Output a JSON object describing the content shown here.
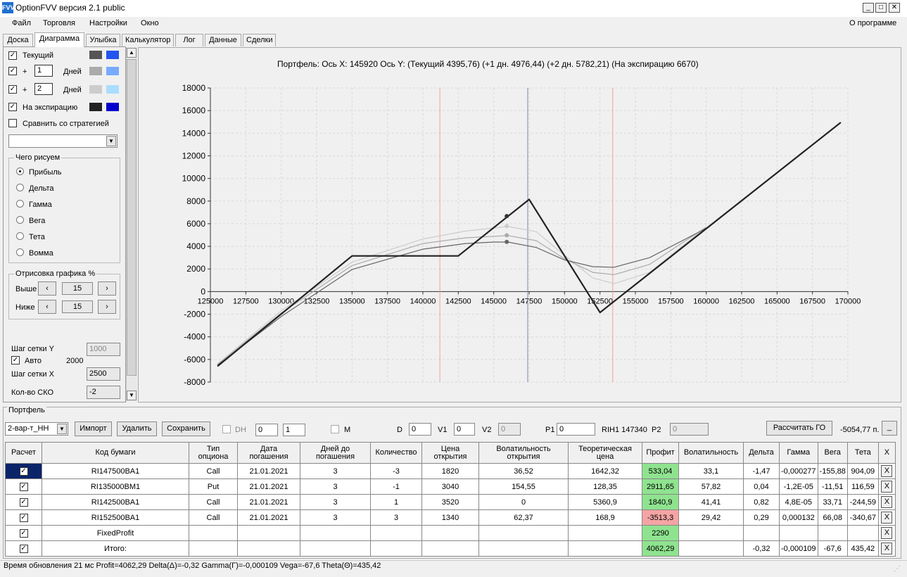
{
  "window": {
    "title": "OptionFVV версия 2.1 public",
    "icon_label": "FVV"
  },
  "menu": [
    "Файл",
    "Торговля",
    "Настройки",
    "Окно"
  ],
  "menu_about": "О программе",
  "tabs": [
    "Доска",
    "Диаграмма",
    "Улыбка",
    "Калькулятор",
    "Лог",
    "Данные",
    "Сделки"
  ],
  "active_tab": "Диаграмма",
  "left": {
    "current_label": "Текущий",
    "plus": "+",
    "days_label": "Дней",
    "days1": "1",
    "days2": "2",
    "expiration_label": "На экспирацию",
    "compare_label": "Сравнить со стратегией",
    "what_group": "Чего рисуем",
    "radios": [
      "Прибыль",
      "Дельта",
      "Гамма",
      "Вега",
      "Тета",
      "Вомма"
    ],
    "selected_radio": "Прибыль",
    "render_group": "Отрисовка графика %",
    "above_label": "Выше",
    "below_label": "Ниже",
    "above_value": "15",
    "below_value": "15",
    "grid_y_label": "Шаг сетки Y",
    "grid_y_value": "1000",
    "auto_label": "Авто",
    "auto_value": "2000",
    "grid_x_label": "Шаг сетки X",
    "grid_x_value": "2500",
    "sko_label": "Кол-во СКО",
    "sko_value": "-2",
    "swatches": {
      "current": [
        "#555555",
        "#2255ee"
      ],
      "d1": [
        "#aaaaaa",
        "#77aaff"
      ],
      "d2": [
        "#cccccc",
        "#aaddff"
      ],
      "exp": [
        "#222222",
        "#0000cc"
      ]
    }
  },
  "chart_header": {
    "text": "Портфель: Ось X: 145920 Ось Y:  (Текущий 4395,76)  (+1 дн. 4976,44)  (+2 дн. 5782,21)  (На экспирацию 6670)"
  },
  "chart_data": {
    "type": "line",
    "xlim": [
      125000,
      170000
    ],
    "ylim": [
      -8000,
      18000
    ],
    "x_ticks": [
      "125000",
      "127500",
      "130000",
      "132500",
      "135000",
      "137500",
      "140000",
      "142500",
      "145000",
      "147500",
      "150000",
      "152500",
      "155000",
      "157500",
      "160000",
      "162500",
      "165000",
      "167500",
      "170000"
    ],
    "y_ticks": [
      "18000",
      "16000",
      "14000",
      "12000",
      "10000",
      "8000",
      "6000",
      "4000",
      "2000",
      "0",
      "-2000",
      "-4000",
      "-6000",
      "-8000"
    ],
    "grid": true,
    "cursor_x": 145920,
    "vlines": [
      {
        "x": 141200,
        "color": "#f4a0a0"
      },
      {
        "x": 147400,
        "color": "#7a8aa8"
      },
      {
        "x": 153400,
        "color": "#f4a0a0"
      }
    ],
    "series": [
      {
        "color": "#222222",
        "x": [
          125500,
          135000,
          142500,
          147500,
          152500,
          169500
        ],
        "y": [
          -6600,
          3150,
          3150,
          8150,
          -1850,
          14950
        ]
      },
      {
        "color": "#cccccc",
        "x": [
          125500,
          130000,
          135000,
          140000,
          143000,
          146000,
          148000,
          150000,
          152000,
          153500,
          156000,
          160000
        ],
        "y": [
          -6400,
          -1700,
          2600,
          4650,
          5350,
          5750,
          5300,
          3200,
          1200,
          700,
          1700,
          5700
        ]
      },
      {
        "color": "#aaaaaa",
        "x": [
          125500,
          130000,
          135000,
          140000,
          143000,
          146000,
          148000,
          150000,
          152000,
          153500,
          156000,
          160000
        ],
        "y": [
          -6450,
          -1900,
          2300,
          4250,
          4750,
          4950,
          4500,
          2900,
          1700,
          1500,
          2400,
          5700
        ]
      },
      {
        "color": "#666666",
        "x": [
          125500,
          130000,
          135000,
          140000,
          143000,
          145000,
          146000,
          148000,
          150000,
          152000,
          153500,
          156000,
          160000
        ],
        "y": [
          -6500,
          -2200,
          1950,
          3750,
          4250,
          4380,
          4380,
          3900,
          2800,
          2200,
          2150,
          3000,
          5600
        ]
      }
    ],
    "points": [
      {
        "x": 145920,
        "y": 6670,
        "color": "#333333"
      },
      {
        "x": 145920,
        "y": 5782,
        "color": "#cccccc"
      },
      {
        "x": 145920,
        "y": 4976,
        "color": "#aaaaaa"
      },
      {
        "x": 145920,
        "y": 4396,
        "color": "#666666"
      }
    ]
  },
  "portfolio": {
    "group_label": "Портфель",
    "selector": "2-вар-т_НН",
    "import": "Импорт",
    "delete": "Удалить",
    "save": "Сохранить",
    "dh_label": "DH",
    "dh_val1": "0",
    "dh_val2": "1",
    "m_label": "M",
    "d_label": "D",
    "d_value": "0",
    "v1_label": "V1",
    "v1_value": "0",
    "v2_label": "V2",
    "v2_value": "0",
    "p1_label": "P1",
    "p1_value": "0",
    "instrument": "RIH1 147340",
    "p2_label": "P2",
    "p2_value": "0",
    "calc_go": "Рассчитать ГО",
    "go_value": "-5054,77 п.",
    "underscore_btn": "_"
  },
  "table": {
    "headers": [
      "Расчет",
      "Код бумаги",
      "Тип\nопциона",
      "Дата\nпогашения",
      "Дней до\nпогашения",
      "Количество",
      "Цена\nоткрытия",
      "Волатильность\nоткрытия",
      "Теоретическая\nцена",
      "Профит",
      "Волатильность",
      "Дельта",
      "Гамма",
      "Вега",
      "Тета",
      "X"
    ],
    "rows": [
      {
        "code": "RI147500BA1",
        "type": "Call",
        "date": "21.01.2021",
        "days": "3",
        "qty": "-3",
        "price": "1820",
        "vol_open": "36,52",
        "theo": "1642,32",
        "profit": "533,04",
        "profit_color": "green",
        "vol": "33,1",
        "delta": "-1,47",
        "gamma": "-0,000277",
        "vega": "-155,88",
        "theta": "904,09"
      },
      {
        "code": "RI135000BM1",
        "type": "Put",
        "date": "21.01.2021",
        "days": "3",
        "qty": "-1",
        "price": "3040",
        "vol_open": "154,55",
        "theo": "128,35",
        "profit": "2911,65",
        "profit_color": "green",
        "vol": "57,82",
        "delta": "0,04",
        "gamma": "-1,2E-05",
        "vega": "-11,51",
        "theta": "116,59"
      },
      {
        "code": "RI142500BA1",
        "type": "Call",
        "date": "21.01.2021",
        "days": "3",
        "qty": "1",
        "price": "3520",
        "vol_open": "0",
        "theo": "5360,9",
        "profit": "1840,9",
        "profit_color": "green",
        "vol": "41,41",
        "delta": "0,82",
        "gamma": "4,8E-05",
        "vega": "33,71",
        "theta": "-244,59"
      },
      {
        "code": "RI152500BA1",
        "type": "Call",
        "date": "21.01.2021",
        "days": "3",
        "qty": "3",
        "price": "1340",
        "vol_open": "62,37",
        "theo": "168,9",
        "profit": "-3513,3",
        "profit_color": "red",
        "vol": "29,42",
        "delta": "0,29",
        "gamma": "0,000132",
        "vega": "66,08",
        "theta": "-340,67"
      },
      {
        "code": "FixedProfit",
        "type": "",
        "date": "",
        "days": "",
        "qty": "",
        "price": "",
        "vol_open": "",
        "theo": "",
        "profit": "2290",
        "profit_color": "green",
        "vol": "",
        "delta": "",
        "gamma": "",
        "vega": "",
        "theta": ""
      },
      {
        "code": "Итого:",
        "type": "",
        "date": "",
        "days": "",
        "qty": "",
        "price": "",
        "vol_open": "",
        "theo": "",
        "profit": "4062,29",
        "profit_color": "green",
        "vol": "",
        "delta": "-0,32",
        "gamma": "-0,000109",
        "vega": "-67,6",
        "theta": "435,42"
      }
    ],
    "x_label": "X"
  },
  "status": "Время обновления 21 мс  Profit=4062,29 Delta(Δ)=-0,32 Gamma(Γ)=-0,000109 Vega=-67,6 Theta(Θ)=435,42"
}
